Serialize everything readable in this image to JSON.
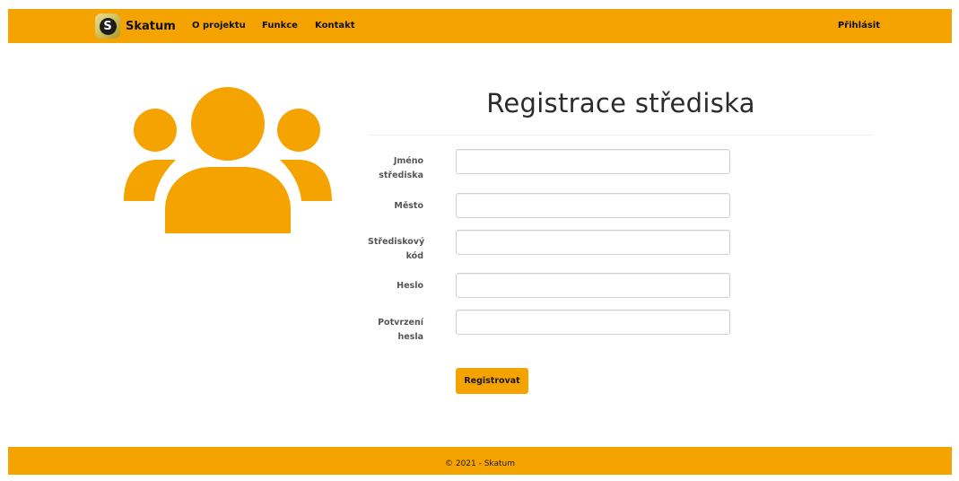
{
  "navbar": {
    "brand_icon_letter": "S",
    "brand_name": "Skatum",
    "links": [
      "O projektu",
      "Funkce",
      "Kontakt"
    ],
    "login": "Přihlásit"
  },
  "hero_icon": "users-group-icon",
  "form": {
    "title": "Registrace střediska",
    "fields": [
      {
        "label_lines": [
          "Jméno",
          "střediska"
        ],
        "value": ""
      },
      {
        "label_lines": [
          "Město"
        ],
        "value": ""
      },
      {
        "label_lines": [
          "Střediskový",
          "kód"
        ],
        "value": ""
      },
      {
        "label_lines": [
          "Heslo"
        ],
        "value": ""
      },
      {
        "label_lines": [
          "Potvrzení",
          "hesla"
        ],
        "value": ""
      }
    ],
    "submit_label": "Registrovat"
  },
  "footer": {
    "text": "© 2021 - Skatum"
  },
  "colors": {
    "accent": "#f5a300",
    "text": "#333333",
    "border": "#cfcfcf"
  }
}
